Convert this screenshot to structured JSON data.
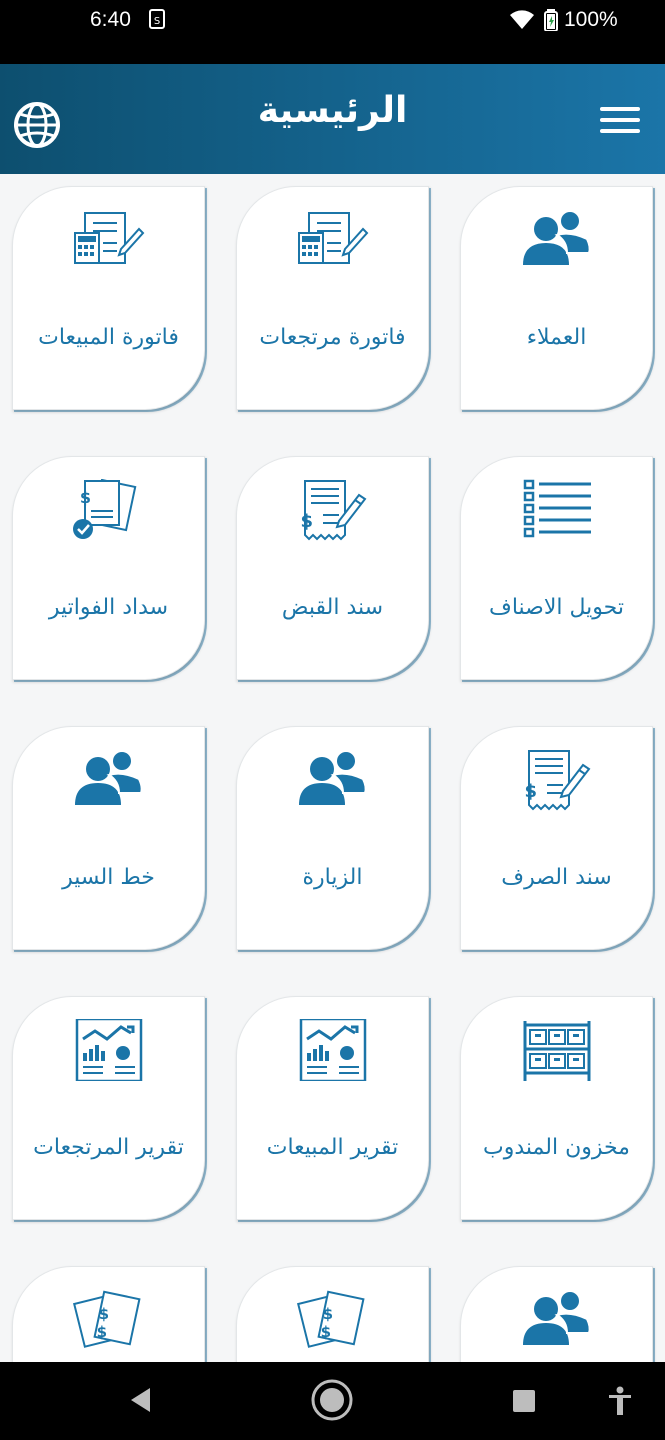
{
  "status_bar": {
    "time": "6:40",
    "battery_pct": "100%"
  },
  "app_bar": {
    "title": "الرئيسية"
  },
  "tiles": [
    {
      "label": "العملاء",
      "icon": "users-icon"
    },
    {
      "label": "فاتورة مرتجعات",
      "icon": "invoice-calculator-icon"
    },
    {
      "label": "فاتورة المبيعات",
      "icon": "invoice-calculator-icon"
    },
    {
      "label": "تحويل الاصناف",
      "icon": "list-icon"
    },
    {
      "label": "سند القبض",
      "icon": "receipt-icon"
    },
    {
      "label": "سداد الفواتير",
      "icon": "bills-check-icon"
    },
    {
      "label": "سند الصرف",
      "icon": "receipt-icon"
    },
    {
      "label": "الزيارة",
      "icon": "users-icon"
    },
    {
      "label": "خط السير",
      "icon": "users-icon"
    },
    {
      "label": "مخزون المندوب",
      "icon": "shelves-icon"
    },
    {
      "label": "تقرير المبيعات",
      "icon": "report-chart-icon"
    },
    {
      "label": "تقرير المرتجعات",
      "icon": "report-chart-icon"
    },
    {
      "label": "",
      "icon": "users-icon"
    },
    {
      "label": "",
      "icon": "bills-icon"
    },
    {
      "label": "",
      "icon": "bills-icon"
    }
  ],
  "colors": {
    "accent": "#1b75a8",
    "header_start": "#0d4f6f",
    "header_end": "#1b75a8"
  }
}
